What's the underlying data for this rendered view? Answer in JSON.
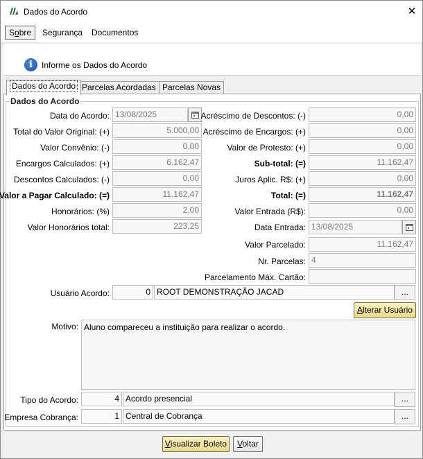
{
  "window": {
    "title": "Dados do Acordo",
    "close": "✕"
  },
  "menu": {
    "sobre_pre": "S",
    "sobre_u": "o",
    "sobre_post": "bre",
    "seguranca": "Segurança",
    "documentos": "Documentos"
  },
  "header": {
    "text": "Informe os Dados do Acordo",
    "icon": "info-icon"
  },
  "tabs": [
    "Dados do Acordo",
    "Parcelas Acordadas",
    "Parcelas Novas"
  ],
  "group_title": "Dados do Acordo",
  "left": {
    "data_acordo": {
      "label": "Data do Acordo:",
      "value": "13/08/2025"
    },
    "total_valor_original": {
      "label": "Total do Valor Original: (+)",
      "value": "5.000,00"
    },
    "valor_convenio": {
      "label": "Valor Convênio: (-)",
      "value": "0,00"
    },
    "encargos_calculados": {
      "label": "Encargos Calculados: (+)",
      "value": "6.162,47"
    },
    "descontos_calculados": {
      "label": "Descontos Calculados: (-)",
      "value": "0,00"
    },
    "valor_a_pagar": {
      "label": "Valor a Pagar Calculado: (=)",
      "value": "11.162,47"
    },
    "honorarios": {
      "label": "Honorários: (%)",
      "value": "2,00"
    },
    "valor_honorarios_total": {
      "label": "Valor Honorários total:",
      "value": "223,25"
    }
  },
  "right": {
    "acrescimo_descontos": {
      "label": "Acréscimo de Descontos: (-)",
      "value": "0,00"
    },
    "acrescimo_encargos": {
      "label": "Acréscimo de Encargos: (+)",
      "value": "0,00"
    },
    "valor_protesto": {
      "label": "Valor de Protesto: (+)",
      "value": "0,00"
    },
    "sub_total": {
      "label": "Sub-total: (=)",
      "value": "11.162,47"
    },
    "juros_aplic": {
      "label": "Juros Aplic. R$: (+)",
      "value": "0,00"
    },
    "total": {
      "label": "Total: (=)",
      "value": "11.162,47"
    },
    "valor_entrada": {
      "label": "Valor Entrada (R$):",
      "value": "0,00"
    },
    "data_entrada": {
      "label": "Data Entrada:",
      "value": "13/08/2025"
    },
    "valor_parcelado": {
      "label": "Valor Parcelado:",
      "value": "11.162,47"
    },
    "nr_parcelas": {
      "label": "Nr. Parcelas:",
      "value": "4"
    },
    "parcelamento_max_cartao": {
      "label": "Parcelamento Máx. Cartão:",
      "value": ""
    }
  },
  "usuario_acordo": {
    "label": "Usuário Acordo:",
    "code": "0",
    "name": "ROOT DEMONSTRAÇÃO JACAD",
    "lookup": "..."
  },
  "alterar_usuario": {
    "pre": "",
    "u": "A",
    "post": "lterar Usuário"
  },
  "motivo": {
    "label": "Motivo:",
    "text": "Aluno compareceu a instituição para realizar o acordo."
  },
  "tipo_acordo": {
    "label": "Tipo do Acordo:",
    "code": "4",
    "name": "Acordo presencial",
    "lookup": "..."
  },
  "empresa_cobranca": {
    "label": "Empresa Cobrança:",
    "code": "1",
    "name": "Central de Cobrança",
    "lookup": "..."
  },
  "buttons": {
    "visualizar_pre": "",
    "visualizar_u": "V",
    "visualizar_post": "isualizar Boleto",
    "voltar_pre": "",
    "voltar_u": "V",
    "voltar_post": "oltar"
  },
  "colors": {
    "button_yellow": "#f3e6a6",
    "info_blue": "#1b4aa0"
  }
}
